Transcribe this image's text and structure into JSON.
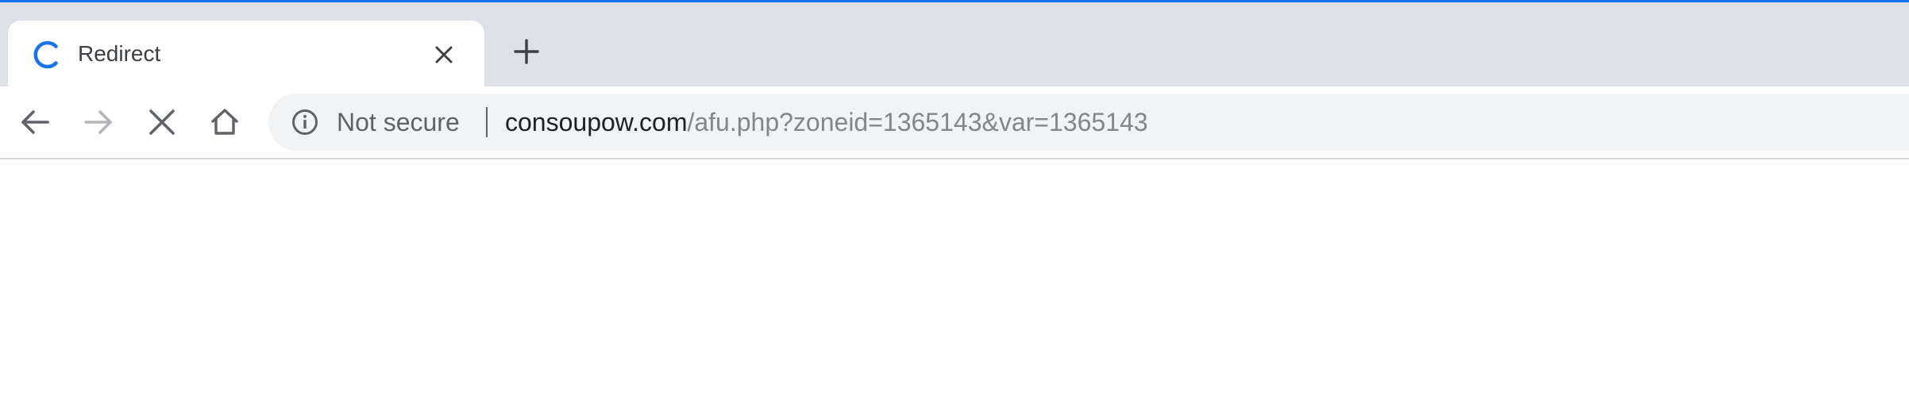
{
  "tab": {
    "title": "Redirect",
    "loading_icon": "loading-spinner-icon",
    "close_icon": "close-icon"
  },
  "tabstrip": {
    "new_tab_icon": "plus-icon"
  },
  "toolbar": {
    "back_icon": "back-arrow-icon",
    "forward_icon": "forward-arrow-icon",
    "forward_enabled": false,
    "stop_icon": "stop-icon",
    "home_icon": "home-icon"
  },
  "omnibox": {
    "security_icon": "info-icon",
    "security_label": "Not secure",
    "url_host": "consoupow.com",
    "url_path": "/afu.php?zoneid=1365143&var=1365143"
  },
  "colors": {
    "accent": "#1a73e8",
    "tabstrip_bg": "#dee1e6",
    "omnibox_bg": "#f1f3f4",
    "icon": "#5f6368",
    "icon_disabled": "#b4b6b9",
    "url_host": "#202124",
    "url_path": "#80868b"
  }
}
